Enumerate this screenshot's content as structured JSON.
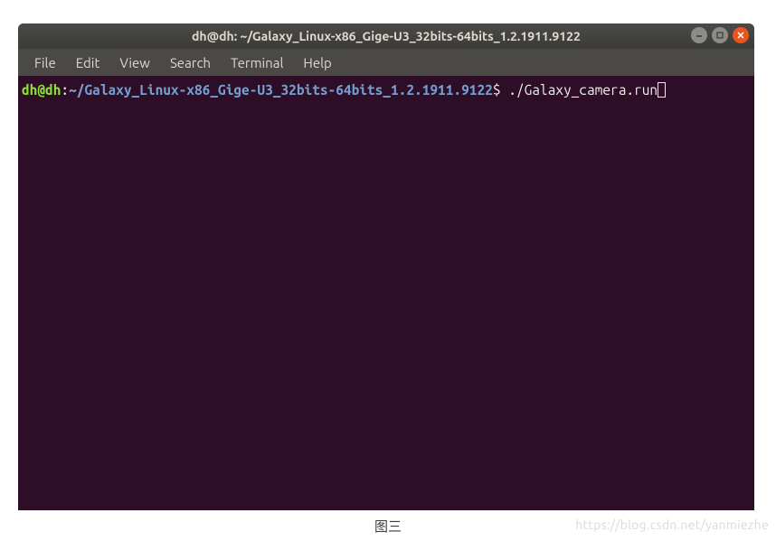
{
  "window": {
    "title": "dh@dh: ~/Galaxy_Linux-x86_Gige-U3_32bits-64bits_1.2.1911.9122"
  },
  "menu": {
    "file": "File",
    "edit": "Edit",
    "view": "View",
    "search": "Search",
    "terminal": "Terminal",
    "help": "Help"
  },
  "prompt": {
    "user_host": "dh@dh",
    "colon": ":",
    "path": "~/Galaxy_Linux-x86_Gige-U3_32bits-64bits_1.2.1911.9122",
    "dollar": "$"
  },
  "command": " ./Galaxy_camera.run",
  "caption": "图三",
  "watermark": "https://blog.csdn.net/yanmiezhe",
  "colors": {
    "bg": "#2e0d26",
    "titlebar": "#3c3b37",
    "menubar": "#4a4946",
    "user": "#8ae234",
    "path": "#729fcf",
    "text": "#eeeeec",
    "close": "#e95420"
  }
}
